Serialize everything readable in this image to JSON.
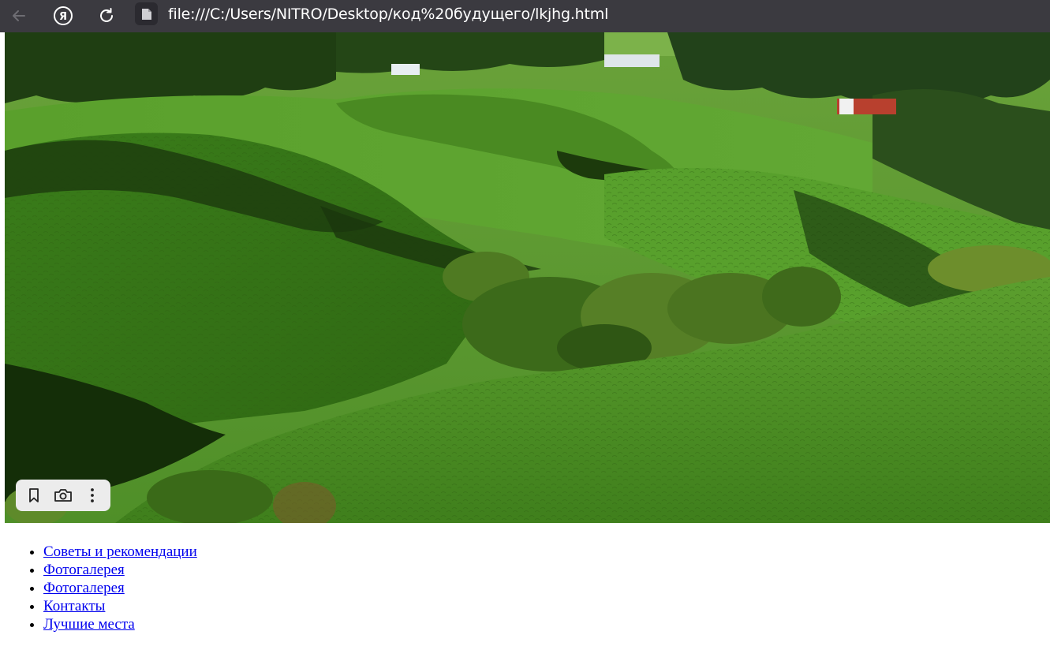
{
  "browser": {
    "address": "file:///C:/Users/NITRO/Desktop/код%20будущего/lkjhg.html",
    "yandex_glyph": "Я"
  },
  "hero": {
    "icons": [
      "bookmark-icon",
      "camera-icon",
      "more-vertical-icon"
    ]
  },
  "nav": {
    "items": [
      {
        "label": "Советы и рекомендации"
      },
      {
        "label": "Фотогалерея"
      },
      {
        "label": "Фотогалерея"
      },
      {
        "label": "Контакты"
      },
      {
        "label": "Лучшие места"
      }
    ]
  },
  "colors": {
    "toolbar_bg": "#3b3a40",
    "link": "#0000ee",
    "grass_light": "#5fa632",
    "grass_dark": "#2f5e12",
    "shadow": "#10250a"
  }
}
